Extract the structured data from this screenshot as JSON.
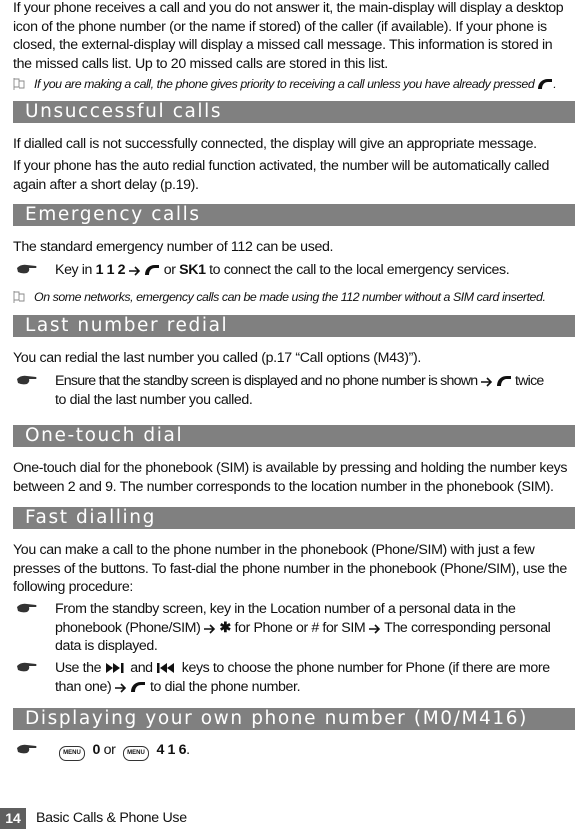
{
  "intro": {
    "line1": "If your phone receives a call and you do not answer it, the main-display will display a desktop",
    "line2": "icon of the phone number (or the name if stored) of the caller (if available). If your phone is",
    "line3": "closed, the external-display will display a missed call message. This information is stored in",
    "line4": "the missed calls list. Up to 20 missed calls are stored in this list.",
    "note": "If you are making a call, the phone gives priority to receiving a call unless you have already pressed",
    "note_end": "."
  },
  "sections": {
    "unsuccessful": {
      "title": "Unsuccessful calls",
      "p1": "If dialled call is not successfully connected, the display will give an appropriate message.",
      "p2_line1": "If your phone has the auto redial function activated, the number will be automatically called",
      "p2_line2": "again after a short delay (p.19)."
    },
    "emergency": {
      "title": "Emergency calls",
      "p1": "The standard emergency number of 112 can be used.",
      "bullet_pre": "Key in",
      "bullet_keys": "1 1 2",
      "bullet_or": "or",
      "bullet_sk": "SK1",
      "bullet_post": "to connect the call to the local emergency services.",
      "note": "On some networks, emergency calls can be made using the 112 number without a SIM card inserted."
    },
    "redial": {
      "title": "Last number redial",
      "p1": "You can redial the last number you called (p.17 “Call options (M43)”).",
      "bullet_pre": "Ensure that the standby screen is displayed and no phone number is shown",
      "bullet_post": "twice",
      "bullet_line2": "to dial the last number you called."
    },
    "onetouch": {
      "title": "One-touch dial",
      "line1": "One-touch dial for the phonebook (SIM) is available by pressing and holding the number keys",
      "line2": "between 2 and 9. The number corresponds to the location number in the phonebook (SIM)."
    },
    "fast": {
      "title": "Fast dialling",
      "line1": "You can make a call to the phone number in the phonebook (Phone/SIM) with just a few",
      "line2": "presses of the buttons. To fast-dial the phone number in the phonebook (Phone/SIM), use the",
      "line3": "following procedure:",
      "b1_line1": "From the standby screen, key in the Location number of a personal data in the",
      "b1_line2_pre": "phonebook (Phone/SIM)",
      "b1_line2_mid": "for Phone or # for SIM",
      "b1_line2_post": "The corresponding personal",
      "b1_line3": "data is displayed.",
      "b2_pre": "Use the",
      "b2_and": "and",
      "b2_post": "keys to choose the phone number for Phone (if there are more",
      "b2_line2_pre": "than one)",
      "b2_line2_post": "to dial the phone number."
    },
    "own": {
      "title": "Displaying your own phone number (M0/M416)",
      "menu_label": "MENU",
      "key1": "0",
      "or": "or",
      "key2": "4 1 6",
      "end": "."
    }
  },
  "footer": {
    "page_number": "14",
    "chapter": "Basic Calls & Phone Use"
  },
  "colors": {
    "header_bg": "#808080",
    "header_text": "#ffffff",
    "footer_badge": "#5f5f5f"
  }
}
